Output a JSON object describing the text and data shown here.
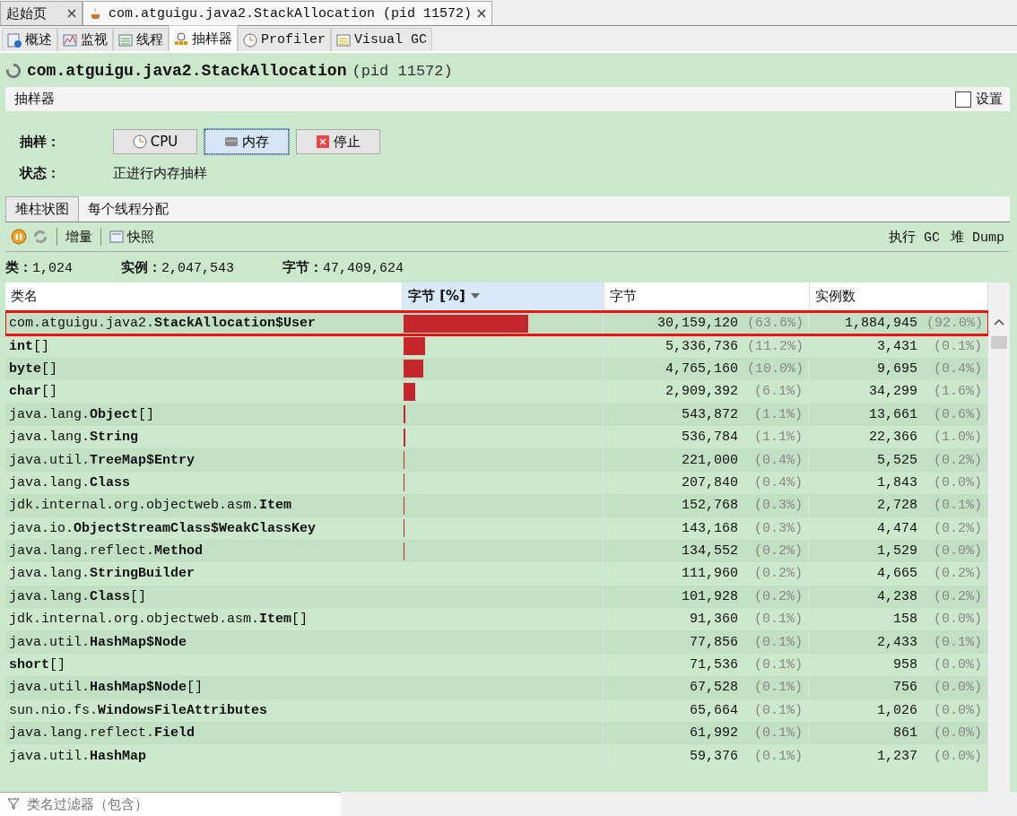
{
  "document_tabs": [
    {
      "label": "起始页",
      "selected": false,
      "kind": "start"
    },
    {
      "label": "com.atguigu.java2.StackAllocation (pid 11572)",
      "selected": true,
      "kind": "app"
    }
  ],
  "view_tabs": [
    {
      "label": "概述",
      "selected": false,
      "kind": "overview"
    },
    {
      "label": "监视",
      "selected": false,
      "kind": "monitor"
    },
    {
      "label": "线程",
      "selected": false,
      "kind": "threads"
    },
    {
      "label": "抽样器",
      "selected": true,
      "kind": "sampler"
    },
    {
      "label": "Profiler",
      "selected": false,
      "kind": "profiler"
    },
    {
      "label": "Visual GC",
      "selected": false,
      "kind": "visualgc"
    }
  ],
  "title": {
    "name": "com.atguigu.java2.StackAllocation",
    "pid": "(pid 11572)"
  },
  "sampler_header": {
    "label": "抽样器",
    "settings": {
      "label": "设置",
      "checked": false
    }
  },
  "sample_row": {
    "label": "抽样：",
    "buttons": [
      {
        "label": "CPU",
        "selected": false,
        "kind": "cpu"
      },
      {
        "label": "内存",
        "selected": true,
        "kind": "memory"
      },
      {
        "label": "停止",
        "selected": false,
        "kind": "stop"
      }
    ]
  },
  "status": {
    "label": "状态：",
    "value": "正进行内存抽样"
  },
  "result_tabs": [
    {
      "label": "堆柱状图",
      "selected": true
    },
    {
      "label": "每个线程分配",
      "selected": false
    }
  ],
  "toolbar": {
    "delta": "增量",
    "snapshot": "快照",
    "gc": "执行 GC",
    "dump": "堆 Dump"
  },
  "stats": [
    {
      "label": "类：",
      "value": "1,024"
    },
    {
      "label": "实例：",
      "value": "2,047,543"
    },
    {
      "label": "字节：",
      "value": "47,409,624"
    }
  ],
  "table": {
    "columns": [
      {
        "label": "类名",
        "sorted": false
      },
      {
        "label": "字节 [%]",
        "sorted": true
      },
      {
        "label": "字节",
        "sorted": false
      },
      {
        "label": "实例数",
        "sorted": false
      }
    ],
    "rows": [
      {
        "name": "com.atguigu.java2.**StackAllocation$User**",
        "level": 0.636,
        "bytes": "30,159,120",
        "bytes_pct": "(63.6%)",
        "instances": "1,884,945",
        "instances_pct": "(92.0%)",
        "highlighted": true
      },
      {
        "name": "**int**[]",
        "level": 0.112,
        "bytes": "5,336,736",
        "bytes_pct": "(11.2%)",
        "instances": "3,431",
        "instances_pct": "(0.1%)",
        "highlighted": false
      },
      {
        "name": "**byte**[]",
        "level": 0.1,
        "bytes": "4,765,160",
        "bytes_pct": "(10.0%)",
        "instances": "9,695",
        "instances_pct": "(0.4%)",
        "highlighted": false
      },
      {
        "name": "**char**[]",
        "level": 0.061,
        "bytes": "2,909,392",
        "bytes_pct": "(6.1%)",
        "instances": "34,299",
        "instances_pct": "(1.6%)",
        "highlighted": false
      },
      {
        "name": "java.lang.**Object**[]",
        "level": 0.011,
        "bytes": "543,872",
        "bytes_pct": "(1.1%)",
        "instances": "13,661",
        "instances_pct": "(0.6%)",
        "highlighted": false
      },
      {
        "name": "java.lang.**String**",
        "level": 0.011,
        "bytes": "536,784",
        "bytes_pct": "(1.1%)",
        "instances": "22,366",
        "instances_pct": "(1.0%)",
        "highlighted": false
      },
      {
        "name": "java.util.**TreeMap$Entry**",
        "level": 0.004,
        "bytes": "221,000",
        "bytes_pct": "(0.4%)",
        "instances": "5,525",
        "instances_pct": "(0.2%)",
        "highlighted": false
      },
      {
        "name": "java.lang.**Class**",
        "level": 0.004,
        "bytes": "207,840",
        "bytes_pct": "(0.4%)",
        "instances": "1,843",
        "instances_pct": "(0.0%)",
        "highlighted": false
      },
      {
        "name": "jdk.internal.org.objectweb.asm.**Item**",
        "level": 0.003,
        "bytes": "152,768",
        "bytes_pct": "(0.3%)",
        "instances": "2,728",
        "instances_pct": "(0.1%)",
        "highlighted": false
      },
      {
        "name": "java.io.**ObjectStreamClass$WeakClassKey**",
        "level": 0.003,
        "bytes": "143,168",
        "bytes_pct": "(0.3%)",
        "instances": "4,474",
        "instances_pct": "(0.2%)",
        "highlighted": false
      },
      {
        "name": "java.lang.reflect.**Method**",
        "level": 0.002,
        "bytes": "134,552",
        "bytes_pct": "(0.2%)",
        "instances": "1,529",
        "instances_pct": "(0.0%)",
        "highlighted": false
      },
      {
        "name": "java.lang.**StringBuilder**",
        "bytes": "111,960",
        "bytes_pct": "(0.2%)",
        "instances": "4,665",
        "instances_pct": "(0.2%)",
        "highlighted": false
      },
      {
        "name": "java.lang.**Class**[]",
        "bytes": "101,928",
        "bytes_pct": "(0.2%)",
        "instances": "4,238",
        "instances_pct": "(0.2%)",
        "highlighted": false
      },
      {
        "name": "jdk.internal.org.objectweb.asm.**Item**[]",
        "bytes": "91,360",
        "bytes_pct": "(0.1%)",
        "instances": "158",
        "instances_pct": "(0.0%)",
        "highlighted": false
      },
      {
        "name": "java.util.**HashMap$Node**",
        "bytes": "77,856",
        "bytes_pct": "(0.1%)",
        "instances": "2,433",
        "instances_pct": "(0.1%)",
        "highlighted": false
      },
      {
        "name": "**short**[]",
        "bytes": "71,536",
        "bytes_pct": "(0.1%)",
        "instances": "958",
        "instances_pct": "(0.0%)",
        "highlighted": false
      },
      {
        "name": "java.util.**HashMap$Node**[]",
        "bytes": "67,528",
        "bytes_pct": "(0.1%)",
        "instances": "756",
        "instances_pct": "(0.0%)",
        "highlighted": false
      },
      {
        "name": "sun.nio.fs.**WindowsFileAttributes**",
        "bytes": "65,664",
        "bytes_pct": "(0.1%)",
        "instances": "1,026",
        "instances_pct": "(0.0%)",
        "highlighted": false
      },
      {
        "name": "java.lang.reflect.**Field**",
        "bytes": "61,992",
        "bytes_pct": "(0.1%)",
        "instances": "861",
        "instances_pct": "(0.0%)",
        "highlighted": false
      },
      {
        "name": "java.util.**HashMap**",
        "bytes": "59,376",
        "bytes_pct": "(0.1%)",
        "instances": "1,237",
        "instances_pct": "(0.0%)",
        "highlighted": false
      }
    ]
  },
  "filter": {
    "placeholder": "类名过滤器（包含）"
  }
}
